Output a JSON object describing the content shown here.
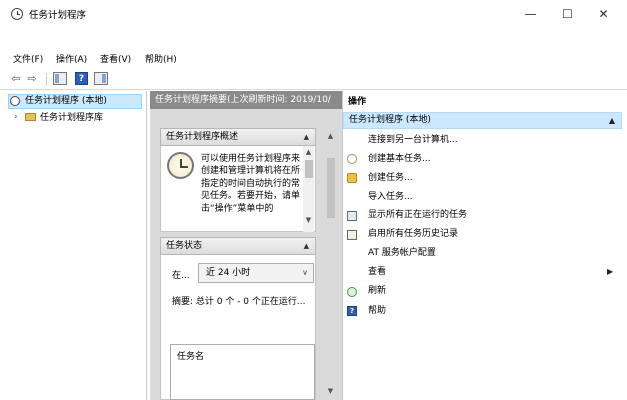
{
  "window": {
    "title": "任务计划程序",
    "controls": [
      "—",
      "☐",
      "✕"
    ]
  },
  "menu": [
    "文件(F)",
    "操作(A)",
    "查看(V)",
    "帮助(H)"
  ],
  "toolbar": {
    "back": "⇦",
    "forward": "⇨",
    "help": "?"
  },
  "tree": {
    "root": "任务计划程序 (本地)",
    "expand_glyph": "›",
    "library": "任务计划程序库"
  },
  "center": {
    "header": "任务计划程序摘要(上次刷新时间: 2019/10/",
    "overview": {
      "title": "任务计划程序概述",
      "text": "可以使用任务计划程序来创建和管理计算机将在所指定的时间自动执行的常见任务。若要开始，请单击“操作”菜单中的"
    },
    "status": {
      "title": "任务状态",
      "at_label": "在...",
      "range_value": "近 24 小时",
      "summary": "摘要: 总计 0 个 - 0 个正在运行...",
      "task_column": "任务名"
    }
  },
  "actions": {
    "header": "操作",
    "subheader": "任务计划程序 (本地)",
    "items": [
      {
        "label": "连接到另一台计算机...",
        "icon": "none"
      },
      {
        "label": "创建基本任务...",
        "icon": "create-basic-task-icon"
      },
      {
        "label": "创建任务...",
        "icon": "create-task-icon"
      },
      {
        "label": "导入任务...",
        "icon": "none"
      },
      {
        "label": "显示所有正在运行的任务",
        "icon": "running-tasks-icon"
      },
      {
        "label": "启用所有任务历史记录",
        "icon": "history-icon"
      },
      {
        "label": "AT 服务帐户配置",
        "icon": "none"
      },
      {
        "label": "查看",
        "icon": "none"
      },
      {
        "label": "刷新",
        "icon": "refresh-icon"
      },
      {
        "label": "帮助",
        "icon": "help-icon"
      }
    ]
  },
  "colors": {
    "selection": "#cce8ff",
    "center_header": "#8a8a8a",
    "panel_bg": "#dadada"
  }
}
